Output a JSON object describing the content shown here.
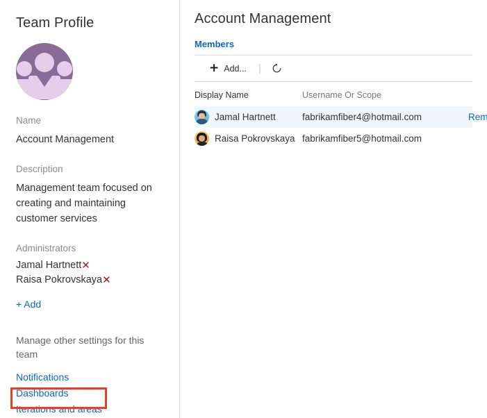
{
  "left": {
    "title": "Team Profile",
    "avatar_icon": "team-group-avatar",
    "name_label": "Name",
    "name_value": "Account Management",
    "description_label": "Description",
    "description_value": "Management team focused on creating and maintaining customer services",
    "administrators_label": "Administrators",
    "administrators": [
      {
        "name": "Jamal Hartnett",
        "remove_icon": "✕"
      },
      {
        "name": "Raisa Pokrovskaya",
        "remove_icon": "✕"
      }
    ],
    "add_admin_label": "+ Add",
    "manage_text": "Manage other settings for this team",
    "manage_links": [
      {
        "label": "Notifications",
        "highlighted": false
      },
      {
        "label": "Dashboards",
        "highlighted": false
      },
      {
        "label": "Iterations and areas",
        "highlighted": true
      }
    ]
  },
  "right": {
    "title": "Account Management",
    "tabs": [
      {
        "label": "Members",
        "active": true
      }
    ],
    "toolbar": {
      "add_label": "Add...",
      "add_icon": "plus-icon",
      "separator": "|",
      "refresh_icon": "refresh-icon"
    },
    "table": {
      "columns": [
        "Display Name",
        "Username Or Scope",
        ""
      ],
      "rows": [
        {
          "avatar": "user-avatar-blue",
          "display_name": "Jamal Hartnett",
          "username": "fabrikamfiber4@hotmail.com",
          "action_label": "Remove",
          "hovered": true
        },
        {
          "avatar": "user-avatar-orange",
          "display_name": "Raisa Pokrovskaya",
          "username": "fabrikamfiber5@hotmail.com",
          "action_label": "",
          "hovered": false
        }
      ]
    }
  },
  "colors": {
    "link": "#0a69c3",
    "avatar_purple": "#8a6a97",
    "avatar_light": "#e6cdeb",
    "admin_x_red": "#9e2018",
    "highlight_red": "#ee3b24",
    "row_hover": "#eff6fc"
  }
}
